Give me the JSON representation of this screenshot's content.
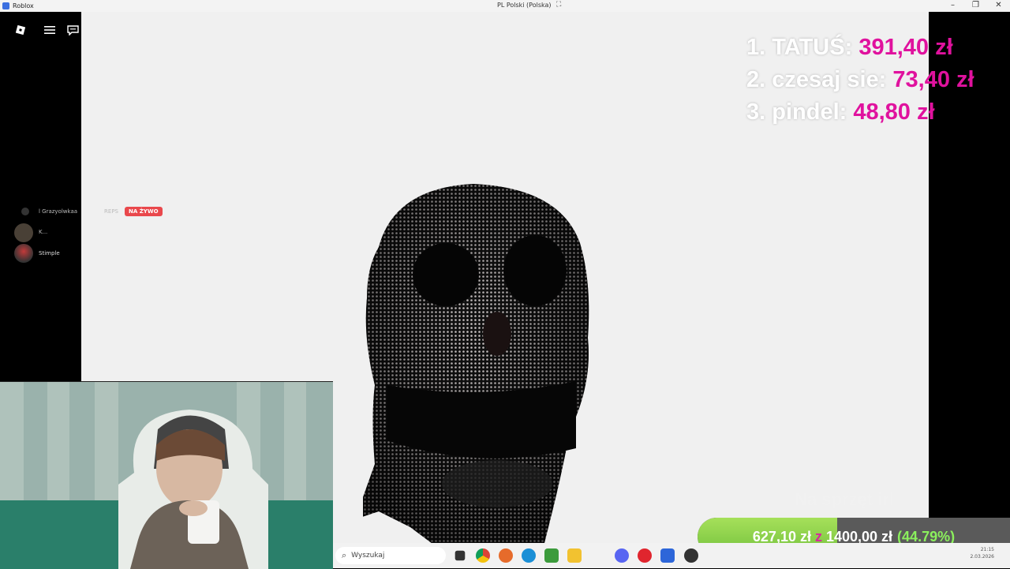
{
  "window": {
    "title": "Roblox",
    "language": "PL Polski (Polska)"
  },
  "chat": {
    "line1": "l Grazyolwkaa",
    "line1_tag": "REPS",
    "live_badge": "NA ŻYWO",
    "line2": "K...",
    "line3": "Stimple"
  },
  "leaderboard": [
    {
      "rank_name": "1. TATUŚ:",
      "amount": "391,40 zł"
    },
    {
      "rank_name": "2. czesaj sie:",
      "amount": "73,40 zł"
    },
    {
      "rank_name": "3. pindel:",
      "amount": "48,80 zł"
    }
  ],
  "goal": {
    "label": "Na sprzęt irl",
    "current": "627,10 zł",
    "sep": "z",
    "target": "1400,00 zł",
    "percent": "(44.79%)",
    "progress": 0.4479,
    "fill_color": "#8fd24c"
  },
  "taskbar": {
    "search_placeholder": "Wyszukaj",
    "date": "2.03.2026",
    "time": "21:15"
  },
  "colors": {
    "leader_amount": "#e0129e",
    "live": "#e9484c"
  }
}
